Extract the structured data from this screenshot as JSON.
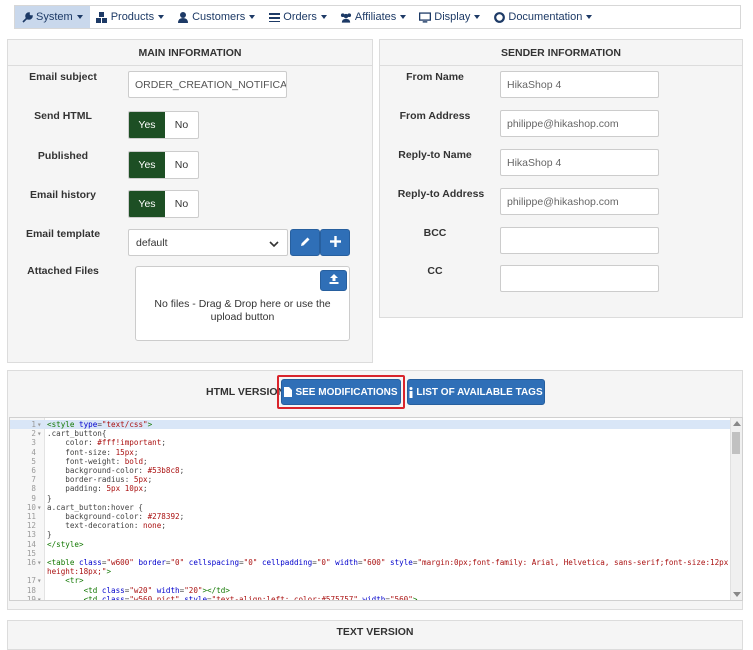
{
  "menu": [
    {
      "label": "System",
      "icon": "wrench-icon",
      "active": true
    },
    {
      "label": "Products",
      "icon": "cubes-icon"
    },
    {
      "label": "Customers",
      "icon": "user-icon"
    },
    {
      "label": "Orders",
      "icon": "list-icon"
    },
    {
      "label": "Affiliates",
      "icon": "users-icon"
    },
    {
      "label": "Display",
      "icon": "monitor-icon"
    },
    {
      "label": "Documentation",
      "icon": "lifering-icon"
    }
  ],
  "main_info": {
    "title": "MAIN INFORMATION",
    "email_subject_label": "Email subject",
    "email_subject_value": "ORDER_CREATION_NOTIFICATION_SUBJECT",
    "send_html_label": "Send HTML",
    "published_label": "Published",
    "email_history_label": "Email history",
    "yes": "Yes",
    "no": "No",
    "email_template_label": "Email template",
    "email_template_value": "default",
    "attached_files_label": "Attached Files",
    "dropzone_text": "No files - Drag & Drop here or use the upload button"
  },
  "sender_info": {
    "title": "SENDER INFORMATION",
    "from_name_label": "From Name",
    "from_name_placeholder": "HikaShop 4",
    "from_address_label": "From Address",
    "from_address_placeholder": "philippe@hikashop.com",
    "reply_to_name_label": "Reply-to Name",
    "reply_to_name_placeholder": "HikaShop 4",
    "reply_to_address_label": "Reply-to Address",
    "reply_to_address_placeholder": "philippe@hikashop.com",
    "bcc_label": "BCC",
    "cc_label": "CC"
  },
  "html_version": {
    "title": "HTML VERSION",
    "see_modifications": "SEE MODIFICATIONS",
    "list_tags": "LIST OF AVAILABLE TAGS"
  },
  "text_version": {
    "title": "TEXT VERSION"
  },
  "colors": {
    "highlight_border": "#d9242b",
    "button_blue": "#2f6fb7",
    "toggle_on": "#1d4f24"
  }
}
